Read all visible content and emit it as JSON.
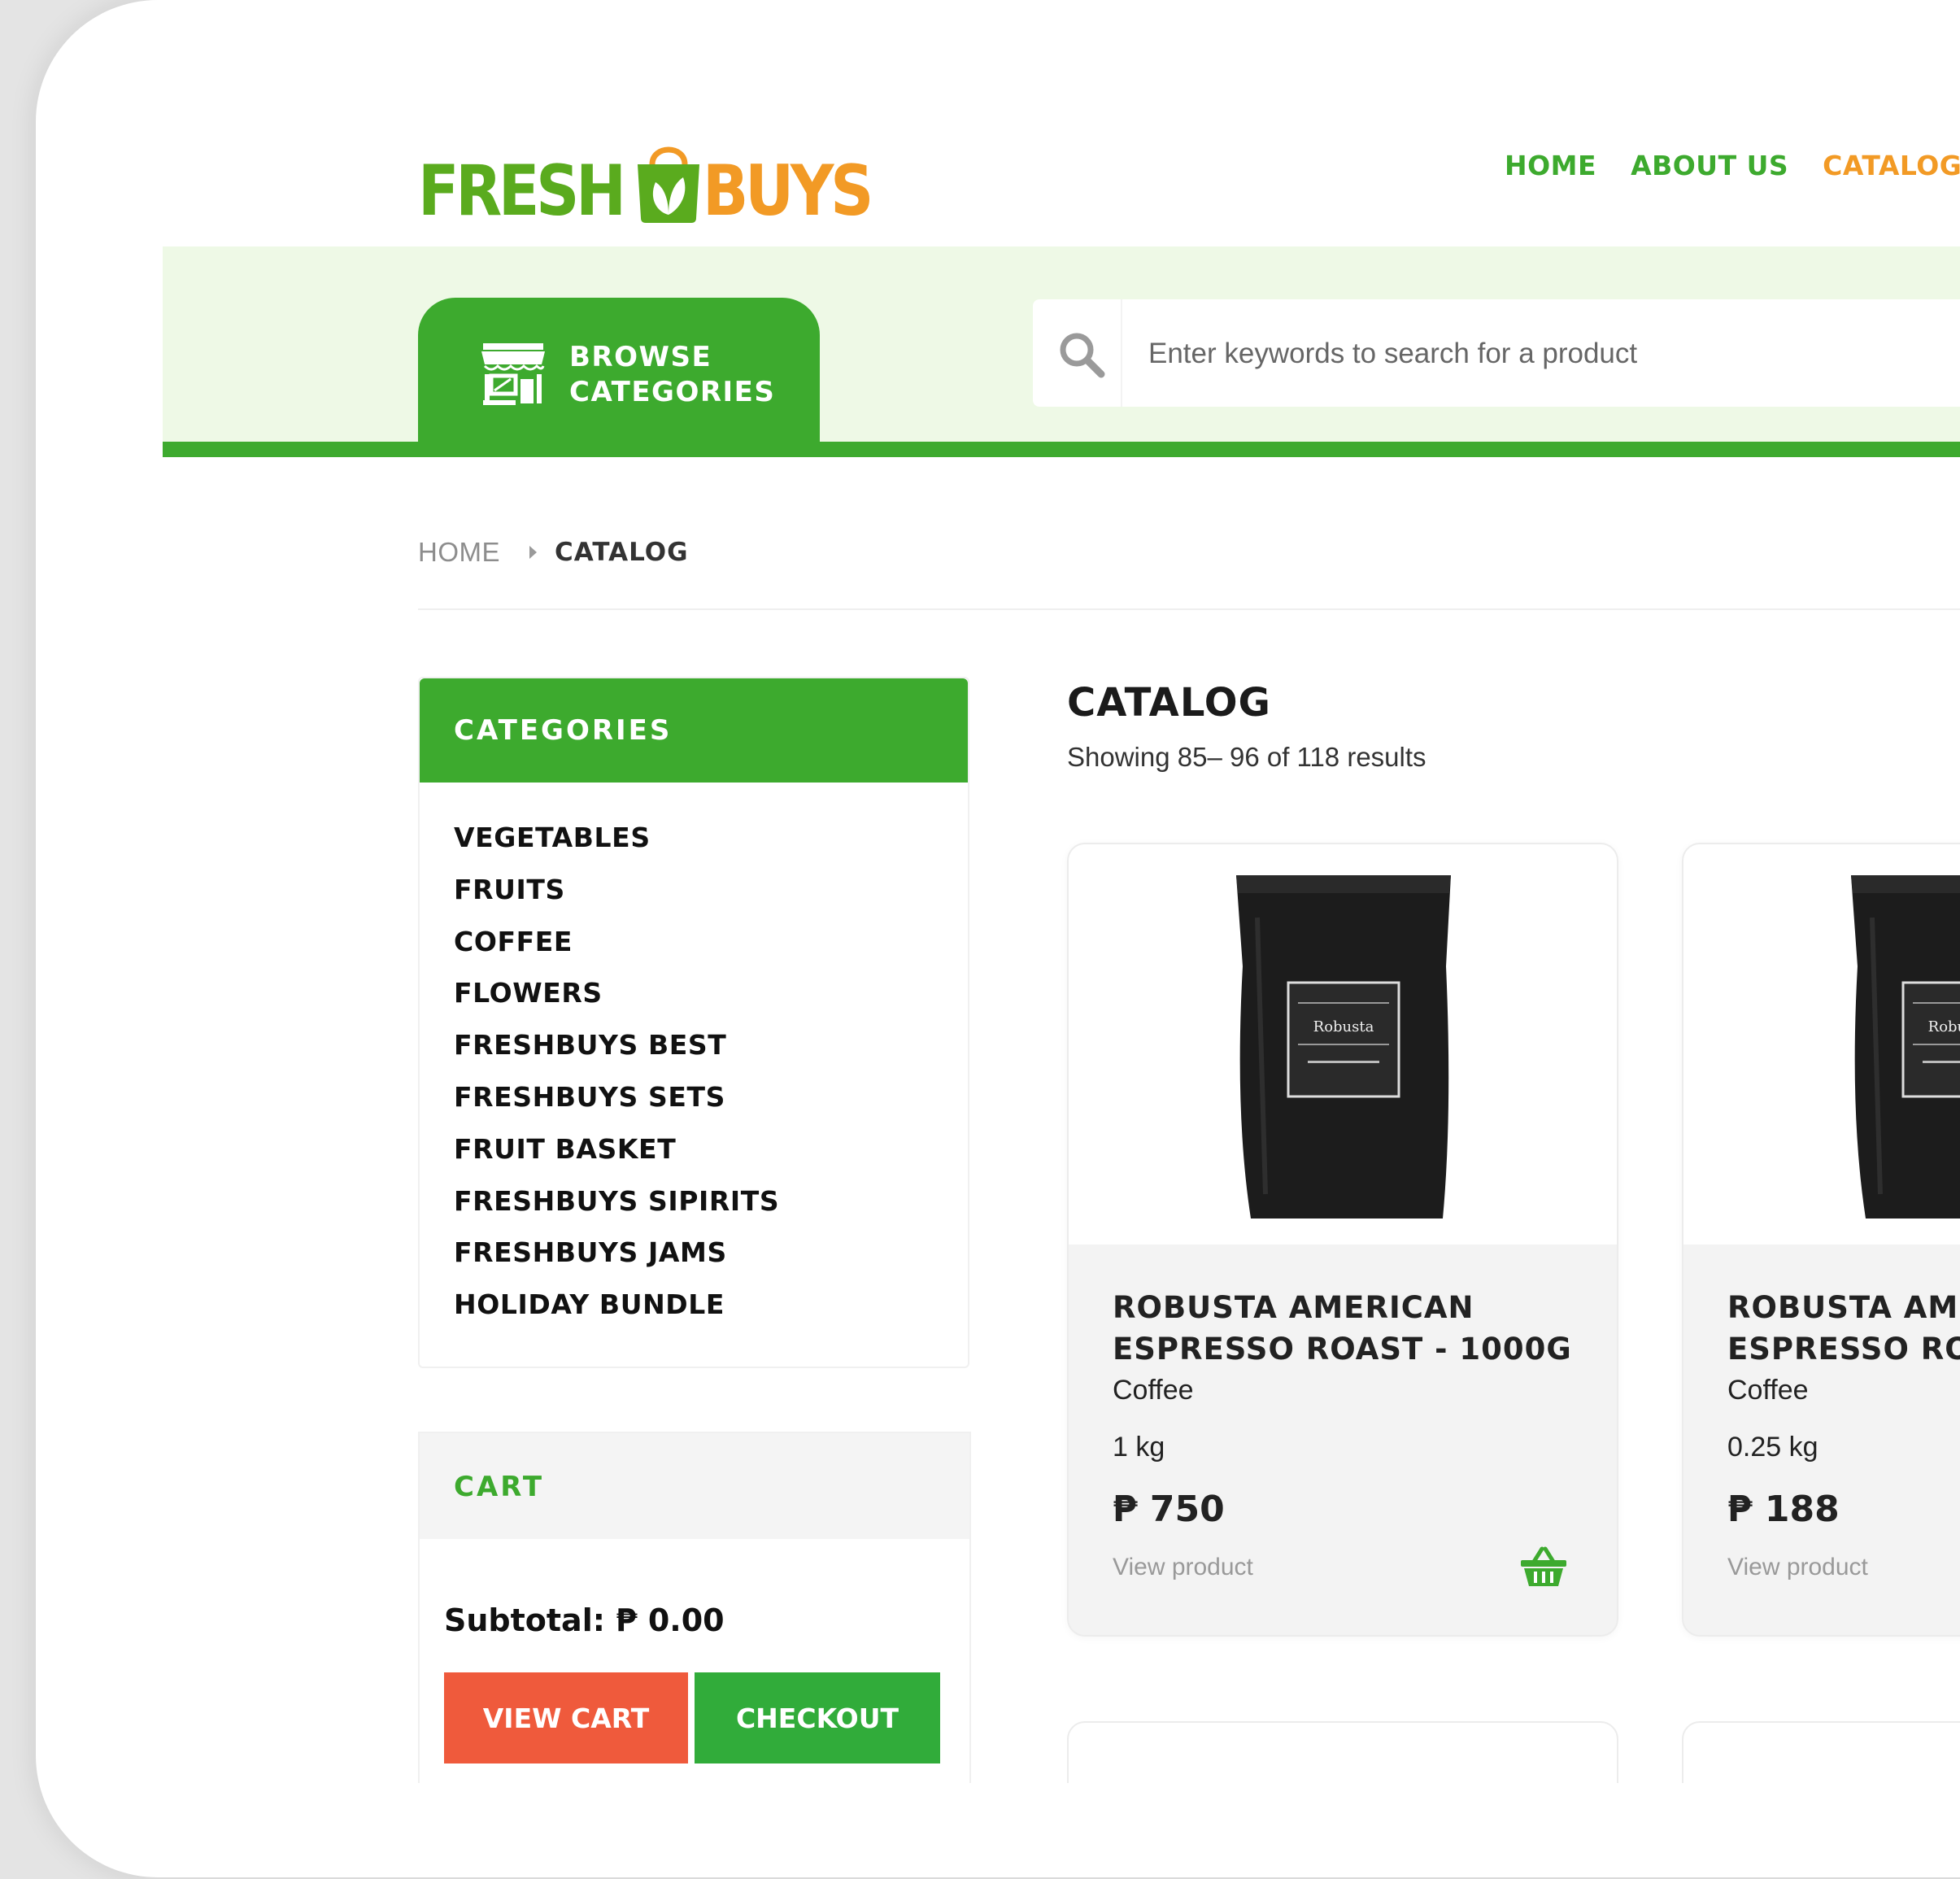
{
  "brand": {
    "fresh": "FRESH",
    "buys": "BUYS",
    "fresh_color": "#5aab1e",
    "buys_color": "#f29a25"
  },
  "nav": {
    "home": "HOME",
    "about": "ABOUT US",
    "catalog": "CATALOG",
    "accent": "#3daa2e",
    "active": "#f29a25"
  },
  "browse": {
    "line1": "BROWSE",
    "line2": "CATEGORIES",
    "icon": "store-icon"
  },
  "search": {
    "placeholder": "Enter keywords to search for a product",
    "icon": "search-icon"
  },
  "breadcrumb": {
    "home": "HOME",
    "current": "CATALOG"
  },
  "sidebar": {
    "title": "CATEGORIES",
    "items": [
      "VEGETABLES",
      "FRUITS",
      "COFFEE",
      "FLOWERS",
      "FRESHBUYS BEST",
      "FRESHBUYS SETS",
      "FRUIT BASKET",
      "FRESHBUYS SIPIRITS",
      "FRESHBUYS JAMS",
      "HOLIDAY BUNDLE"
    ]
  },
  "cart": {
    "title": "CART",
    "subtotal": "Subtotal: ₱ 0.00",
    "view_cart": "VIEW CART",
    "checkout": "CHECKOUT"
  },
  "catalog": {
    "title": "CATALOG",
    "results": "Showing 85– 96 of 118 results",
    "products": [
      {
        "name_line1": "ROBUSTA AMERICAN",
        "name_line2": "ESPRESSO ROAST - 1000G",
        "category": "Coffee",
        "weight": "1 kg",
        "price": "₱ 750",
        "view": "View product",
        "label_title": "Robusta"
      },
      {
        "name_line1": "ROBUSTA AMERICAN",
        "name_line2": "ESPRESSO ROAST",
        "category": "Coffee",
        "weight": "0.25 kg",
        "price": "₱ 188",
        "view": "View product",
        "label_title": "Robusta"
      }
    ]
  },
  "colors": {
    "green": "#3daa2e",
    "orange": "#f29a25",
    "red": "#ef5a3c",
    "band": "#eef9e6"
  }
}
